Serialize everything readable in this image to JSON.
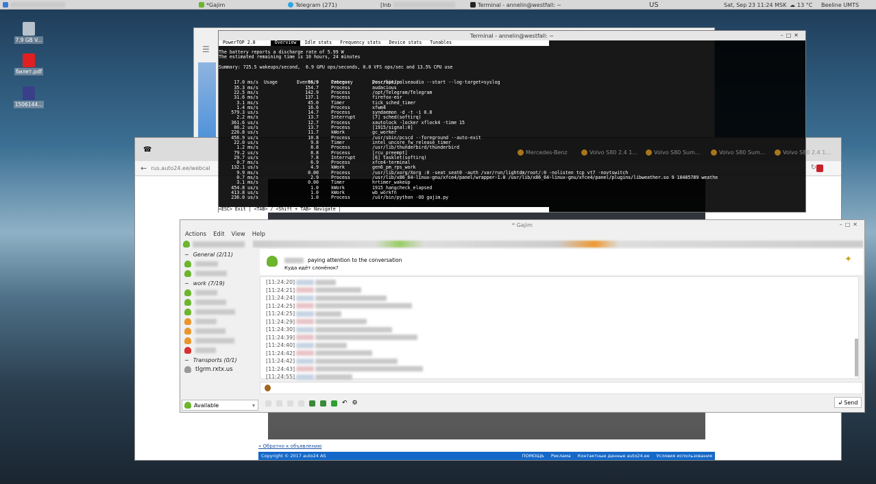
{
  "taskbar": {
    "items": [
      "*Gajim",
      "Telegram (271)",
      "[Inb",
      "Terminal - annelin@westfall: ~"
    ],
    "keyboard": "US",
    "clock": "Sat, Sep 23  11:24 MSK",
    "weather": "13 °C",
    "network": "Beeline UMTS"
  },
  "desktop": {
    "icons": [
      {
        "label": "7.9 GB V...",
        "icon": "drive-icon"
      },
      {
        "label": "билет.pdf",
        "icon": "pdf-icon"
      },
      {
        "label": "1506144...",
        "icon": "video-icon"
      }
    ]
  },
  "browser": {
    "url": "rus.auto24.ee/webcal",
    "bookmarks": [
      "Mercedes-Benz",
      "Mercedes-Benz",
      "Volvo S80 2.4 1...",
      "Volvo S80 Sum...",
      "Volvo S80 Sum...",
      "Volvo S80 2.4 1..."
    ],
    "back_link": "« Обратно к объявлению",
    "footer": {
      "copyright": "Copyright © 2017 auto24 AS",
      "links": [
        "ПОМОЩЬ",
        "Реклама",
        "Контактные данные auto24.ee",
        "Условия использования"
      ]
    }
  },
  "terminal": {
    "title": "Terminal - annelin@westfall: ~",
    "app": "PowerTOP 2.8",
    "tabs": [
      "Overview",
      "Idle stats",
      "Frequency stats",
      "Device stats",
      "Tunables"
    ],
    "active_tab": "Overview",
    "lines": [
      "The battery reports a discharge rate of 5.99 W",
      "The estimated remaining time is 10 hours, 24 minutes",
      "Summary: 725.5 wakeups/second,  6.9 GPU ops/seconds, 0.0 VFS ops/sec and 13.5% CPU use"
    ],
    "headers": [
      "Usage",
      "Events/s",
      "Category",
      "Description"
    ],
    "rows": [
      [
        "17.0 ms/s",
        "96.9",
        "Process",
        "/usr/bin/pulseaudio --start --log-target=syslog"
      ],
      [
        "35.3 ms/s",
        "154.7",
        "Process",
        "audacious"
      ],
      [
        "22.5 ms/s",
        "142.9",
        "Process",
        "/opt/Telegram/Telegram"
      ],
      [
        "31.6 ms/s",
        "137.1",
        "Process",
        "firefox-esr"
      ],
      [
        "3.1 ms/s",
        "45.0",
        "Timer",
        "tick_sched_timer"
      ],
      [
        "1.4 ms/s",
        "16.6",
        "Process",
        "xfwm4"
      ],
      [
        "579.3 us/s",
        "14.7",
        "Process",
        "syndaemon -d -t -i 0.8"
      ],
      [
        "2.2 ms/s",
        "13.7",
        "Interrupt",
        "[7] sched(softirq)"
      ],
      [
        "361.6 us/s",
        "12.7",
        "Process",
        "xautolock -locker xflock4 -time 15"
      ],
      [
        "86.2 us/s",
        "13.7",
        "Process",
        "[1915/signal:0]"
      ],
      [
        "226.8 us/s",
        "11.7",
        "kWork",
        "gc_worker"
      ],
      [
        "456.9 us/s",
        "10.8",
        "Process",
        "/usr/sbin/pcscd --foreground --auto-exit"
      ],
      [
        "22.0 us/s",
        "9.8",
        "Timer",
        "intel_uncore_fw_release_timer"
      ],
      [
        "1.2 ms/s",
        "8.8",
        "Process",
        "/usr/lib/thunderbird/thunderbird"
      ],
      [
        "79.2 us/s",
        "8.8",
        "Process",
        "[rcu_preempt]"
      ],
      [
        "29.7 us/s",
        "7.8",
        "Interrupt",
        "[6] tasklet(softirq)"
      ],
      [
        "0.7 ms/s",
        "6.9",
        "Process",
        "xfce4-terminal"
      ],
      [
        "132.1 us/s",
        "4.9",
        "kWork",
        "gen6_pm_rps_work"
      ],
      [
        "9.9 ms/s",
        "0.00",
        "Process",
        "/usr/lib/xorg/Xorg :0 -seat seat0 -auth /var/run/lightdm/root/:0 -nolisten tcp vt7 -novtswitch"
      ],
      [
        "0.7 ms/s",
        "2.9",
        "Process",
        "/usr/lib/x86_64-linux-gnu/xfce4/panel/wrapper-1.0 /usr/lib/x86_64-linux-gnu/xfce4/panel/plugins/libweather.so 9 10485789 weathe"
      ],
      [
        "3.1 ms/s",
        "0.00",
        "Timer",
        "hrtimer_wakeup"
      ],
      [
        "454.8 us/s",
        "1.0",
        "kWork",
        "1915_hangcheck_elapsed"
      ],
      [
        "413.8 us/s",
        "1.0",
        "kWork",
        "wb_workfn"
      ],
      [
        "236.0 us/s",
        "1.0",
        "Process",
        "/usr/bin/python -OO gajim.py"
      ]
    ],
    "status_line": "<ESC> Exit | <TAB> / <Shift + TAB> Navigate |"
  },
  "gajim": {
    "title": "* Gajim",
    "menu": [
      "Actions",
      "Edit",
      "View",
      "Help"
    ],
    "roster": [
      {
        "type": "group",
        "label": "General (2/11)"
      },
      {
        "type": "contact",
        "color": "#6cb52d"
      },
      {
        "type": "contact",
        "color": "#6cb52d"
      },
      {
        "type": "group",
        "label": "work (7/19)"
      },
      {
        "type": "contact",
        "color": "#6cb52d"
      },
      {
        "type": "contact",
        "color": "#6cb52d"
      },
      {
        "type": "contact",
        "color": "#6cb52d"
      },
      {
        "type": "contact",
        "color": "#e8962c"
      },
      {
        "type": "contact",
        "color": "#e8962c"
      },
      {
        "type": "contact",
        "color": "#e8962c"
      },
      {
        "type": "contact",
        "color": "#d83030"
      },
      {
        "type": "group",
        "label": "Transports (0/1)"
      },
      {
        "type": "contact",
        "color": "#999999",
        "label": "tlgrm.rxtx.us"
      }
    ],
    "status": "Available",
    "chat_state": "paying attention to the conversation",
    "chat_status_msg": "Куда идёт слонёнок?",
    "timestamps": [
      "[11:24:20]",
      "[11:24:21]",
      "[11:24:24]",
      "[11:24:25]",
      "[11:24:25]",
      "[11:24:29]",
      "[11:24:30]",
      "[11:24:39]",
      "[11:24:40]",
      "[11:24:42]",
      "[11:24:42]",
      "[11:24:43]",
      "[11:24:55]"
    ],
    "send_label": "Send"
  }
}
